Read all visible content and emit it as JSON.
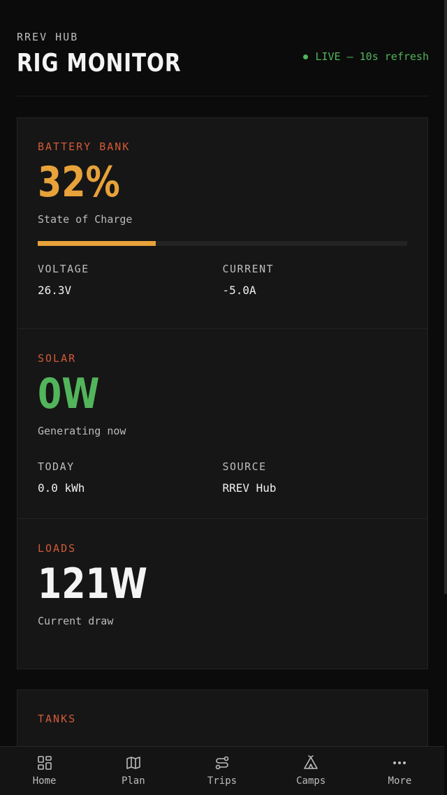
{
  "header": {
    "kicker": "RREV HUB",
    "title": "RIG MONITOR",
    "live_status": "LIVE — 10s refresh"
  },
  "battery": {
    "label": "BATTERY BANK",
    "percent": "32%",
    "charge_fraction": 0.32,
    "sub": "State of Charge",
    "voltage_label": "VOLTAGE",
    "voltage_value": "26.3V",
    "current_label": "CURRENT",
    "current_value": "-5.0A"
  },
  "solar": {
    "label": "SOLAR",
    "value": "0W",
    "sub": "Generating now",
    "today_label": "TODAY",
    "today_value": "0.0 kWh",
    "source_label": "SOURCE",
    "source_value": "RREV Hub"
  },
  "loads": {
    "label": "LOADS",
    "value": "121W",
    "sub": "Current draw"
  },
  "tanks": {
    "label": "TANKS"
  },
  "nav": {
    "items": [
      {
        "label": "Home",
        "icon": "grid-icon"
      },
      {
        "label": "Plan",
        "icon": "map-icon"
      },
      {
        "label": "Trips",
        "icon": "route-icon"
      },
      {
        "label": "Camps",
        "icon": "tent-icon"
      },
      {
        "label": "More",
        "icon": "more-dots-icon"
      }
    ]
  },
  "colors": {
    "accent_orange": "#e7a23a",
    "section_label": "#d35a37",
    "live_green": "#52b55b"
  }
}
